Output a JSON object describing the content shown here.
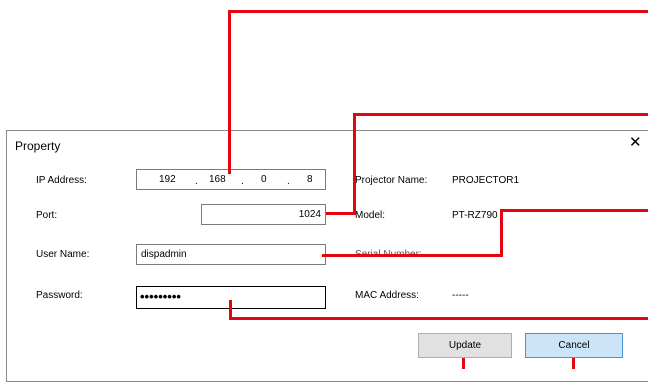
{
  "dialog": {
    "title": "Property",
    "close_glyph": "✕"
  },
  "fields": {
    "ip_label": "IP Address:",
    "ip_octets": [
      "192",
      "168",
      "0",
      "8"
    ],
    "ip_separator": ".",
    "port_label": "Port:",
    "port_value": "1024",
    "username_label": "User Name:",
    "username_value": "dispadmin",
    "password_label": "Password:",
    "password_mask": "•••••••••"
  },
  "info": {
    "projector_name_label": "Projector Name:",
    "projector_name_value": "PROJECTOR1",
    "model_label": "Model:",
    "model_value": "PT-RZ790",
    "serial_label": "Serial Number:",
    "mac_label": "MAC Address:",
    "mac_value": "-----"
  },
  "buttons": {
    "update": "Update",
    "cancel": "Cancel"
  },
  "colors": {
    "callout": "#e3050f",
    "cancel_bg": "#cce4f7",
    "cancel_border": "#4a93d8"
  }
}
